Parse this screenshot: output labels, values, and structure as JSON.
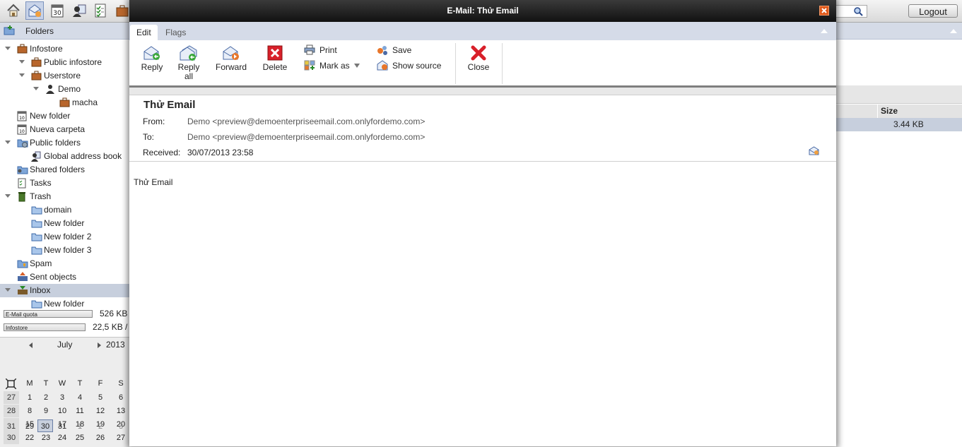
{
  "topbar": {
    "logout_label": "Logout",
    "calendar_badge": "30"
  },
  "folders": {
    "header_label": "Folders",
    "items": [
      {
        "label": "Infostore"
      },
      {
        "label": "Public infostore"
      },
      {
        "label": "Userstore"
      },
      {
        "label": "Demo"
      },
      {
        "label": "macha"
      },
      {
        "label": "New folder"
      },
      {
        "label": "Nueva carpeta"
      },
      {
        "label": "Public folders"
      },
      {
        "label": "Global address book"
      },
      {
        "label": "Shared folders"
      },
      {
        "label": "Tasks"
      },
      {
        "label": "Trash"
      },
      {
        "label": "domain"
      },
      {
        "label": "New folder"
      },
      {
        "label": "New folder 2"
      },
      {
        "label": "New folder 3"
      },
      {
        "label": "Spam"
      },
      {
        "label": "Sent objects"
      },
      {
        "label": "Inbox"
      },
      {
        "label": "New folder"
      }
    ],
    "calendar_icon_text": "10"
  },
  "quota": {
    "email_label": "E-Mail quota",
    "email_value": "526 KB",
    "infostore_label": "Infostore",
    "infostore_value": "22,5 KB /"
  },
  "calendar": {
    "month": "July",
    "year": "2013",
    "weekdays": [
      "M",
      "T",
      "W",
      "T",
      "F",
      "S"
    ],
    "weeks": [
      {
        "wk": "27",
        "days": [
          "1",
          "2",
          "3",
          "4",
          "5",
          "6"
        ]
      },
      {
        "wk": "28",
        "days": [
          "8",
          "9",
          "10",
          "11",
          "12",
          "13"
        ]
      },
      {
        "wk": "29",
        "days": [
          "15",
          "16",
          "17",
          "18",
          "19",
          "20"
        ]
      },
      {
        "wk": "30",
        "days": [
          "22",
          "23",
          "24",
          "25",
          "26",
          "27"
        ]
      },
      {
        "wk": "31",
        "days": [
          "29",
          "30",
          "31",
          "1",
          "2",
          "3"
        ]
      }
    ]
  },
  "list": {
    "size_header": "Size",
    "size_value": "3.44 KB"
  },
  "email_window": {
    "title": "E-Mail: Thử Email",
    "tabs": [
      {
        "label": "Edit"
      },
      {
        "label": "Flags"
      }
    ],
    "ribbon": {
      "reply": "Reply",
      "reply_all_1": "Reply",
      "reply_all_2": "all",
      "forward": "Forward",
      "delete": "Delete",
      "print": "Print",
      "mark_as": "Mark as",
      "save": "Save",
      "show_source": "Show source",
      "close": "Close"
    },
    "subject": "Thử Email",
    "from_label": "From:",
    "from_value": "Demo <preview@demoenterpriseemail.com.onlyfordemo.com>",
    "to_label": "To:",
    "to_value": "Demo <preview@demoenterpriseemail.com.onlyfordemo.com>",
    "received_label": "Received:",
    "received_value": "30/07/2013 23:58",
    "body": "Thử Email"
  },
  "colors": {
    "accent_header": "#d5dbe7",
    "selection": "#c7cfdd",
    "title_bar": "#111111",
    "close_button": "#e05a1c"
  }
}
